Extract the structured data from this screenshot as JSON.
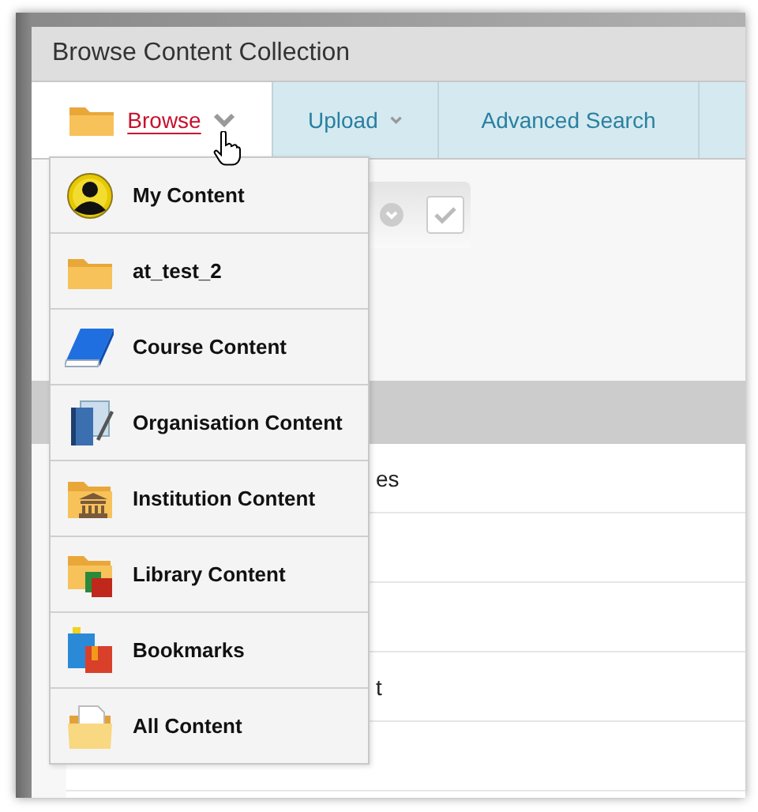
{
  "dialog": {
    "title": "Browse Content Collection"
  },
  "tabs": [
    {
      "label": "Browse",
      "selected": true,
      "dropdown": true
    },
    {
      "label": "Upload",
      "selected": false,
      "dropdown": true
    },
    {
      "label": "Advanced Search",
      "selected": false,
      "dropdown": false
    }
  ],
  "browse_menu": [
    {
      "label": "My Content",
      "kind": "person"
    },
    {
      "label": "at_test_2",
      "kind": "folder"
    },
    {
      "label": "Course Content",
      "kind": "book"
    },
    {
      "label": "Organisation Content",
      "kind": "notebook"
    },
    {
      "label": "Institution Content",
      "kind": "institution"
    },
    {
      "label": "Library Content",
      "kind": "library"
    },
    {
      "label": "Bookmarks",
      "kind": "bookmarks"
    },
    {
      "label": "All Content",
      "kind": "all"
    }
  ],
  "list_rows": [
    {
      "text": "es"
    },
    {},
    {},
    {
      "text": "t"
    },
    {}
  ]
}
